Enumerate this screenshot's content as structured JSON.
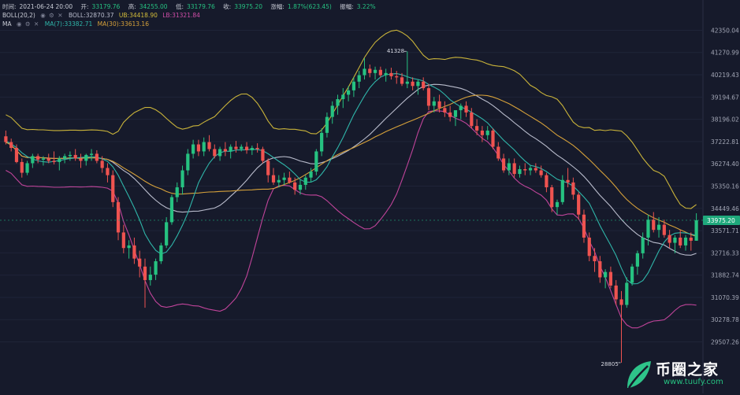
{
  "header": {
    "time_label": "时间:",
    "time_value": "2021-06-24 20:00",
    "open_label": "开:",
    "open_value": "33179.76",
    "high_label": "高:",
    "high_value": "34255.00",
    "low_label": "低:",
    "low_value": "33179.76",
    "close_label": "收:",
    "close_value": "33975.20",
    "change_label": "涨幅:",
    "change_value": "1.87%(623.45)",
    "amp_label": "振幅:",
    "amp_value": "3.22%"
  },
  "indicators": {
    "boll_name": "BOLL(20,2)",
    "boll_text": "BOLL:32870.37",
    "ub_text": "UB:34418.90",
    "lb_text": "LB:31321.84",
    "ma_name": "MA",
    "ma7_text": "MA(7):33382.71",
    "ma30_text": "MA(30):33613.16"
  },
  "watermark": {
    "title": "币圈之家",
    "url": "www.tuufy.com"
  },
  "colors": {
    "background": "#161a2b",
    "up": "#26c281",
    "down": "#ef5350",
    "boll_mid": "#b9bccc",
    "boll_ub": "#c9b33a",
    "boll_lb": "#c0449a",
    "ma7": "#2fb5a9",
    "ma30": "#d6a13a",
    "price_tag": "#1fa97c"
  },
  "chart_data": {
    "type": "candlestick",
    "y_ticks": [
      "42350.04",
      "41270.99",
      "40219.43",
      "39194.67",
      "38196.02",
      "37222.81",
      "36274.40",
      "35350.16",
      "34449.46",
      "33571.71",
      "32716.33",
      "31882.74",
      "31070.39",
      "30278.78",
      "29507.26"
    ],
    "y_range": [
      29200,
      42600
    ],
    "y_scale": "log",
    "current_price": "33975.20",
    "annotations": [
      {
        "text": "41328",
        "x": 62,
        "y": 41328
      },
      {
        "text": "28805",
        "x": 132,
        "y": 28805
      }
    ],
    "ohlc": [
      [
        37450,
        37700,
        37100,
        37200
      ],
      [
        37200,
        37350,
        36800,
        36950
      ],
      [
        36950,
        37100,
        36300,
        36350
      ],
      [
        36350,
        36500,
        35700,
        35900
      ],
      [
        35900,
        36400,
        35800,
        36300
      ],
      [
        36300,
        36700,
        36100,
        36600
      ],
      [
        36600,
        36700,
        36300,
        36450
      ],
      [
        36450,
        36600,
        36200,
        36500
      ],
      [
        36500,
        36700,
        36300,
        36400
      ],
      [
        36400,
        36800,
        36250,
        36350
      ],
      [
        36350,
        36600,
        36000,
        36500
      ],
      [
        36500,
        36700,
        36300,
        36600
      ],
      [
        36600,
        36800,
        36400,
        36650
      ],
      [
        36650,
        36900,
        36400,
        36500
      ],
      [
        36500,
        36700,
        36100,
        36400
      ],
      [
        36400,
        36700,
        36200,
        36650
      ],
      [
        36650,
        36900,
        36400,
        36700
      ],
      [
        36700,
        36850,
        36300,
        36400
      ],
      [
        36400,
        36600,
        35900,
        36100
      ],
      [
        36100,
        36300,
        35500,
        35800
      ],
      [
        35800,
        36000,
        34500,
        34700
      ],
      [
        34700,
        34900,
        33200,
        33500
      ],
      [
        33500,
        33800,
        32700,
        32900
      ],
      [
        32900,
        33200,
        32500,
        33000
      ],
      [
        33000,
        33300,
        32300,
        32500
      ],
      [
        32500,
        32800,
        31800,
        32200
      ],
      [
        32200,
        32500,
        30700,
        31700
      ],
      [
        31700,
        32200,
        31500,
        31900
      ],
      [
        31900,
        32500,
        31700,
        32400
      ],
      [
        32400,
        33100,
        32300,
        33000
      ],
      [
        33000,
        34100,
        32900,
        33900
      ],
      [
        33900,
        35000,
        33800,
        34900
      ],
      [
        34900,
        35500,
        34700,
        35300
      ],
      [
        35300,
        36200,
        35000,
        36000
      ],
      [
        36000,
        36900,
        35800,
        36700
      ],
      [
        36700,
        37300,
        36500,
        37100
      ],
      [
        37100,
        37300,
        36600,
        36800
      ],
      [
        36800,
        37400,
        36600,
        37200
      ],
      [
        37200,
        37500,
        36800,
        36900
      ],
      [
        36900,
        37100,
        36500,
        36600
      ],
      [
        36600,
        37000,
        36400,
        36900
      ],
      [
        36900,
        37200,
        36600,
        36800
      ],
      [
        36800,
        37100,
        36500,
        37000
      ],
      [
        37000,
        37250,
        36750,
        36900
      ],
      [
        36900,
        37100,
        36800,
        37000
      ],
      [
        37000,
        37200,
        36700,
        36850
      ],
      [
        36850,
        37050,
        36650,
        36950
      ],
      [
        36950,
        37150,
        36750,
        36900
      ],
      [
        36900,
        37000,
        36300,
        36400
      ],
      [
        36400,
        36500,
        35500,
        35800
      ],
      [
        35800,
        36100,
        35400,
        35500
      ],
      [
        35500,
        35800,
        35300,
        35600
      ],
      [
        35600,
        35900,
        35400,
        35700
      ],
      [
        35700,
        35950,
        35450,
        35500
      ],
      [
        35500,
        35700,
        35000,
        35200
      ],
      [
        35200,
        35600,
        35000,
        35400
      ],
      [
        35400,
        35800,
        35200,
        35700
      ],
      [
        35700,
        36100,
        35500,
        35950
      ],
      [
        35950,
        36900,
        35800,
        36800
      ],
      [
        36800,
        37800,
        36600,
        37600
      ],
      [
        37600,
        38500,
        37400,
        38300
      ],
      [
        38300,
        39000,
        38000,
        38800
      ],
      [
        38800,
        39300,
        38400,
        39100
      ],
      [
        39100,
        39600,
        38700,
        39300
      ],
      [
        39300,
        39700,
        39000,
        39500
      ],
      [
        39500,
        40100,
        39200,
        39900
      ],
      [
        39900,
        40400,
        39600,
        40200
      ],
      [
        40200,
        41000,
        40000,
        40500
      ],
      [
        40500,
        40700,
        40100,
        40300
      ],
      [
        40300,
        40600,
        40000,
        40450
      ],
      [
        40450,
        40600,
        40100,
        40200
      ],
      [
        40200,
        40500,
        39900,
        40300
      ],
      [
        40300,
        40550,
        40000,
        40150
      ],
      [
        40150,
        40400,
        39800,
        40100
      ],
      [
        40100,
        40300,
        39700,
        39800
      ],
      [
        39800,
        41328,
        39600,
        39900
      ],
      [
        39900,
        40100,
        39500,
        39700
      ],
      [
        39700,
        40000,
        39300,
        39900
      ],
      [
        39900,
        40100,
        39500,
        39600
      ],
      [
        39600,
        39800,
        38600,
        38800
      ],
      [
        38800,
        39200,
        38500,
        39000
      ],
      [
        39000,
        39300,
        38500,
        38700
      ],
      [
        38700,
        39000,
        38300,
        38500
      ],
      [
        38500,
        38800,
        38100,
        38300
      ],
      [
        38300,
        38600,
        37900,
        38600
      ],
      [
        38600,
        38900,
        38200,
        38800
      ],
      [
        38800,
        39000,
        38300,
        38500
      ],
      [
        38500,
        38700,
        37800,
        37900
      ],
      [
        37900,
        38200,
        37500,
        37700
      ],
      [
        37700,
        37900,
        37200,
        37500
      ],
      [
        37500,
        37900,
        37300,
        37700
      ],
      [
        37700,
        37800,
        36900,
        37000
      ],
      [
        37000,
        37200,
        36400,
        36500
      ],
      [
        36500,
        36700,
        35900,
        36000
      ],
      [
        36000,
        36500,
        35800,
        36300
      ],
      [
        36300,
        36500,
        35700,
        35850
      ],
      [
        35850,
        36200,
        35700,
        36050
      ],
      [
        36050,
        36300,
        35800,
        36000
      ],
      [
        36000,
        36200,
        35800,
        36100
      ],
      [
        36100,
        36300,
        35900,
        36000
      ],
      [
        36000,
        36200,
        35700,
        35800
      ],
      [
        35800,
        35900,
        35100,
        35300
      ],
      [
        35300,
        35400,
        34300,
        34500
      ],
      [
        34500,
        34800,
        34200,
        34700
      ],
      [
        34700,
        35800,
        34600,
        35600
      ],
      [
        35600,
        36100,
        35300,
        35500
      ],
      [
        35500,
        35700,
        34800,
        35000
      ],
      [
        35000,
        35100,
        34000,
        34200
      ],
      [
        34200,
        34400,
        33100,
        33300
      ],
      [
        33300,
        33500,
        32400,
        32600
      ],
      [
        32600,
        32900,
        32000,
        32400
      ],
      [
        32400,
        32600,
        31600,
        31800
      ],
      [
        31800,
        32100,
        31400,
        32000
      ],
      [
        32000,
        32200,
        31400,
        31500
      ],
      [
        31500,
        31700,
        30800,
        31000
      ],
      [
        31000,
        31300,
        28805,
        30800
      ],
      [
        30800,
        31800,
        30700,
        31600
      ],
      [
        31600,
        32300,
        31500,
        32200
      ],
      [
        32200,
        32800,
        31900,
        32700
      ],
      [
        32700,
        33500,
        32500,
        33300
      ],
      [
        33300,
        34200,
        33000,
        34000
      ],
      [
        34000,
        34300,
        33500,
        33600
      ],
      [
        33600,
        34100,
        33300,
        33800
      ],
      [
        33800,
        34000,
        33300,
        33400
      ],
      [
        33400,
        33600,
        32900,
        33100
      ],
      [
        33100,
        33400,
        32700,
        33300
      ],
      [
        33300,
        33600,
        32900,
        33000
      ],
      [
        33000,
        33400,
        32800,
        33300
      ],
      [
        33300,
        33500,
        32800,
        33180
      ],
      [
        33180,
        34255,
        33180,
        33975
      ]
    ],
    "ma7": [
      37250,
      37120,
      36960,
      36740,
      36580,
      36480,
      36400,
      36360,
      36340,
      36380,
      36410,
      36460,
      36500,
      36520,
      36540,
      36560,
      36580,
      36560,
      36480,
      36380,
      36150,
      35800,
      35350,
      34920,
      34470,
      33990,
      33440,
      33090,
      32810,
      32670,
      32750,
      33010,
      33370,
      33780,
      34260,
      34860,
      35490,
      35920,
      36300,
      36580,
      36740,
      36810,
      36800,
      36860,
      36860,
      36870,
      36890,
      36880,
      36830,
      36700,
      36540,
      36380,
      36230,
      36060,
      35850,
      35620,
      35510,
      35510,
      35610,
      35850,
      36150,
      36570,
      36960,
      37400,
      37900,
      38400,
      38830,
      39250,
      39620,
      39900,
      40110,
      40220,
      40250,
      40280,
      40220,
      40130,
      40050,
      40000,
      39930,
      39770,
      39650,
      39510,
      39310,
      39070,
      38900,
      38750,
      38640,
      38510,
      38370,
      38220,
      38040,
      37780,
      37530,
      37280,
      37070,
      36860,
      36610,
      36390,
      36210,
      36160,
      36080,
      35950,
      35790,
      35630,
      35550,
      35480,
      35350,
      35130,
      34900,
      34650,
      34220,
      33770,
      33380,
      33010,
      32620,
      32140,
      31720,
      31560,
      31570,
      31680,
      31970,
      32380,
      32790,
      33130,
      33360,
      33470,
      33490,
      33480,
      33440,
      33380
    ]
  }
}
